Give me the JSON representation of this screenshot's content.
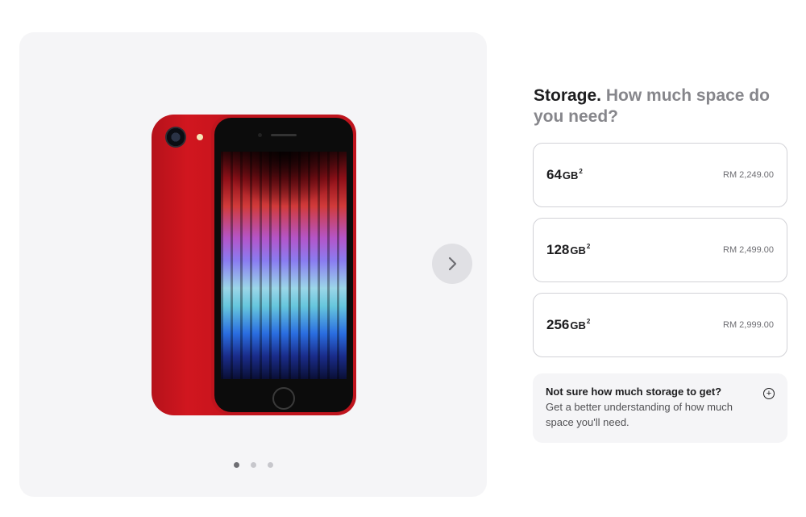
{
  "gallery": {
    "next_icon": "chevron-right-icon",
    "dots_total": 3,
    "active_dot": 1
  },
  "storage": {
    "title": "Storage.",
    "subtitle": "How much space do you need?",
    "options": [
      {
        "capacity": "64",
        "unit": "GB",
        "footnote": "2",
        "price": "RM 2,249.00"
      },
      {
        "capacity": "128",
        "unit": "GB",
        "footnote": "2",
        "price": "RM 2,499.00"
      },
      {
        "capacity": "256",
        "unit": "GB",
        "footnote": "2",
        "price": "RM 2,999.00"
      }
    ]
  },
  "help": {
    "title": "Not sure how much storage to get?",
    "body": "Get a better understanding of how much space you'll need.",
    "icon": "plus-circle-icon"
  },
  "colors": {
    "product_red": "#bf141d",
    "panel_bg": "#f5f5f7",
    "border": "#d2d2d7",
    "text_secondary": "#86868b"
  }
}
